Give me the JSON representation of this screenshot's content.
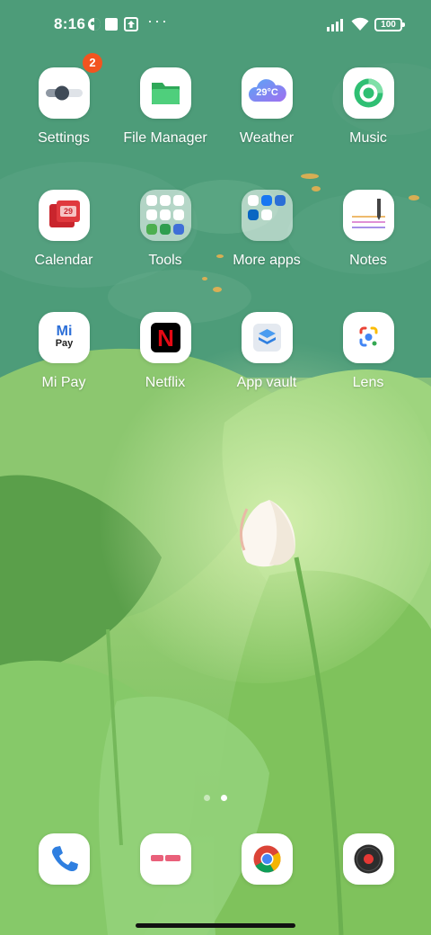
{
  "status_bar": {
    "time": "8:16",
    "overflow": "···",
    "battery": "100",
    "icons": [
      "vpn-icon",
      "square-notification-icon",
      "upload-icon",
      "signal-icon",
      "wifi-icon",
      "battery-icon"
    ]
  },
  "home": {
    "apps": [
      {
        "label": "Settings",
        "icon": "settings-icon",
        "badge": "2"
      },
      {
        "label": "File Manager",
        "icon": "folder-icon"
      },
      {
        "label": "Weather",
        "icon": "weather-cloud-icon",
        "temp": "29°C"
      },
      {
        "label": "Music",
        "icon": "music-disc-icon"
      },
      {
        "label": "Calendar",
        "icon": "calendar-icon",
        "day": "29"
      },
      {
        "label": "Tools",
        "icon": "tools-folder-icon"
      },
      {
        "label": "More apps",
        "icon": "more-apps-folder-icon"
      },
      {
        "label": "Notes",
        "icon": "notes-pen-icon"
      },
      {
        "label": "Mi Pay",
        "icon": "mi-pay-icon",
        "logo_top": "Mi",
        "logo_bottom": "Pay"
      },
      {
        "label": "Netflix",
        "icon": "netflix-icon",
        "logo": "N"
      },
      {
        "label": "App vault",
        "icon": "app-vault-icon"
      },
      {
        "label": "Lens",
        "icon": "google-lens-icon"
      }
    ]
  },
  "page_indicator": {
    "pages": 2,
    "active": 2
  },
  "dock": [
    {
      "icon": "phone-icon"
    },
    {
      "icon": "messages-icon"
    },
    {
      "icon": "chrome-icon"
    },
    {
      "icon": "recorder-icon"
    }
  ],
  "colors": {
    "badge": "#f2541f",
    "netflix": "#e50914",
    "calendar": "#e0393e",
    "file_manager": "#3dbf6a",
    "music": "#2fbf73"
  }
}
